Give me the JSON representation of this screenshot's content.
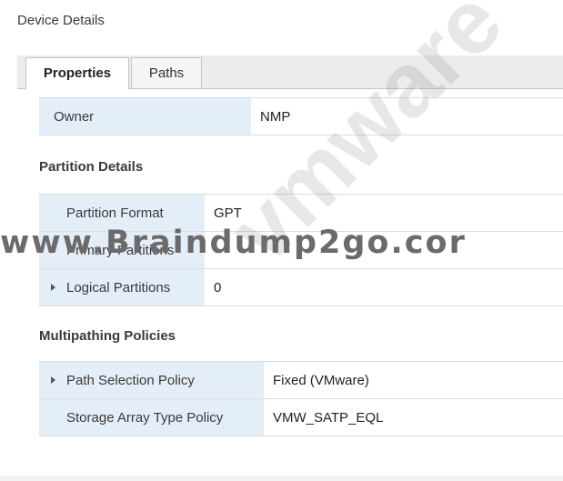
{
  "page_title": "Device Details",
  "tabs": [
    {
      "label": "Properties",
      "active": true
    },
    {
      "label": "Paths",
      "active": false
    }
  ],
  "owner": {
    "label": "Owner",
    "value": "NMP"
  },
  "partition_details": {
    "title": "Partition Details",
    "rows": [
      {
        "label": "Partition Format",
        "value": "GPT",
        "expandable": false
      },
      {
        "label": "Primary Partitions",
        "value": "",
        "expandable": true
      },
      {
        "label": "Logical Partitions",
        "value": "0",
        "expandable": true
      }
    ]
  },
  "multipathing": {
    "title": "Multipathing Policies",
    "rows": [
      {
        "label": "Path Selection Policy",
        "value": "Fixed (VMware)",
        "expandable": true
      },
      {
        "label": "Storage Array Type Policy",
        "value": "VMW_SATP_EQL",
        "expandable": false
      }
    ]
  },
  "watermark": {
    "text": "www.Braindump2go.cor",
    "logo": "vmware"
  },
  "colors": {
    "label_bg": "#e4eef8",
    "border": "#dcdcdc",
    "tabbar_bg": "#ececec"
  }
}
